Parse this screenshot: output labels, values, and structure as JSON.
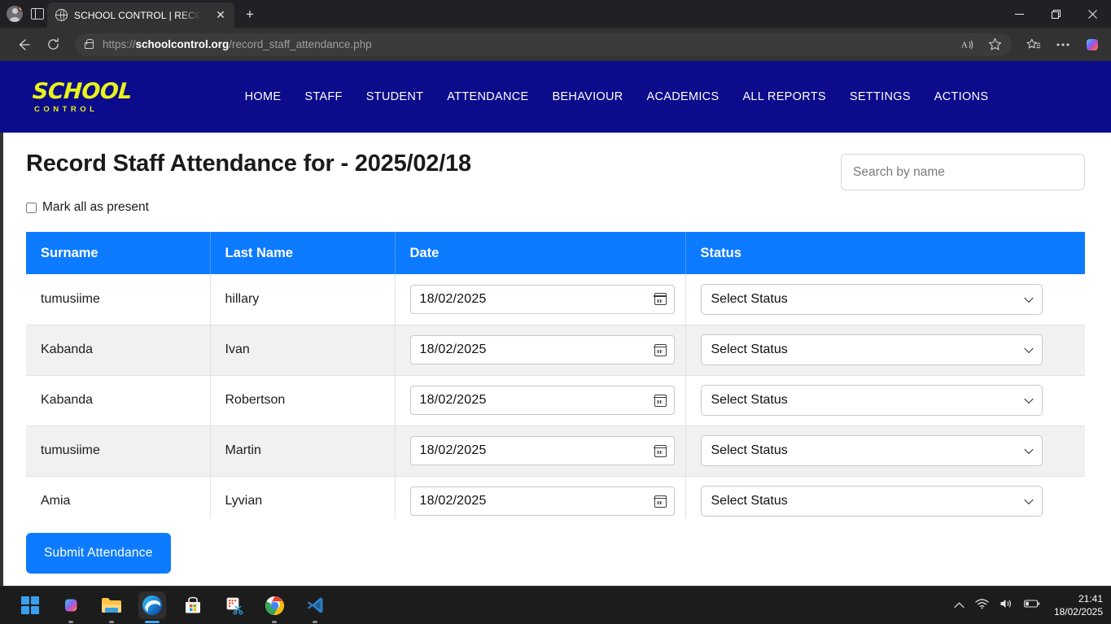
{
  "browser": {
    "tab": {
      "title": "SCHOOL CONTROL | RECORD STA",
      "close_label": "✕"
    },
    "new_tab_label": "+",
    "url_prefix": "https://",
    "url_domain": "schoolcontrol.org",
    "url_path": "/record_staff_attendance.php",
    "window_controls": {
      "minimize": "—",
      "restore": "❐",
      "close": "✕"
    }
  },
  "site": {
    "logo_main": "SCHOOL",
    "logo_sub": "CONTROL",
    "nav": [
      {
        "label": "HOME"
      },
      {
        "label": "STAFF"
      },
      {
        "label": "STUDENT"
      },
      {
        "label": "ATTENDANCE"
      },
      {
        "label": "BEHAVIOUR"
      },
      {
        "label": "ACADEMICS"
      },
      {
        "label": "ALL REPORTS"
      },
      {
        "label": "SETTINGS"
      },
      {
        "label": "ACTIONS"
      }
    ],
    "nav_bg": "#0b0b8b",
    "logo_color": "#e8f31a",
    "accent_blue": "#0d7bff"
  },
  "page": {
    "title": "Record Staff Attendance for - 2025/02/18",
    "search_placeholder": "Search by name",
    "search_value": "",
    "mark_all_label": "Mark all as present",
    "submit_label": "Submit Attendance"
  },
  "table": {
    "headers": [
      "Surname",
      "Last Name",
      "Date",
      "Status"
    ],
    "status_placeholder": "Select Status",
    "rows": [
      {
        "surname": "tumusiime",
        "last_name": "hillary",
        "date": "18/02/2025",
        "status": "Select Status"
      },
      {
        "surname": "Kabanda",
        "last_name": "Ivan",
        "date": "18/02/2025",
        "status": "Select Status"
      },
      {
        "surname": "Kabanda",
        "last_name": "Robertson",
        "date": "18/02/2025",
        "status": "Select Status"
      },
      {
        "surname": "tumusiime",
        "last_name": "Martin",
        "date": "18/02/2025",
        "status": "Select Status"
      },
      {
        "surname": "Amia",
        "last_name": "Lyvian",
        "date": "18/02/2025",
        "status": "Select Status"
      }
    ]
  },
  "taskbar": {
    "time": "21:41",
    "date": "18/02/2025"
  }
}
